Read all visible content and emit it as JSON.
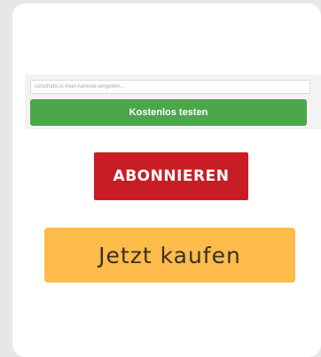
{
  "signup": {
    "email_placeholder": "Geschäfts-E-Mail-Adresse eingeben...",
    "trial_button_label": "Kostenlos testen"
  },
  "subscribe": {
    "label": "ABONNIEREN"
  },
  "buy": {
    "label": "Jetzt kaufen"
  },
  "colors": {
    "trial_green": "#4aa74b",
    "subscribe_red": "#c81d25",
    "buy_orange": "#fdbc4b",
    "page_background": "#e6e7e9"
  }
}
